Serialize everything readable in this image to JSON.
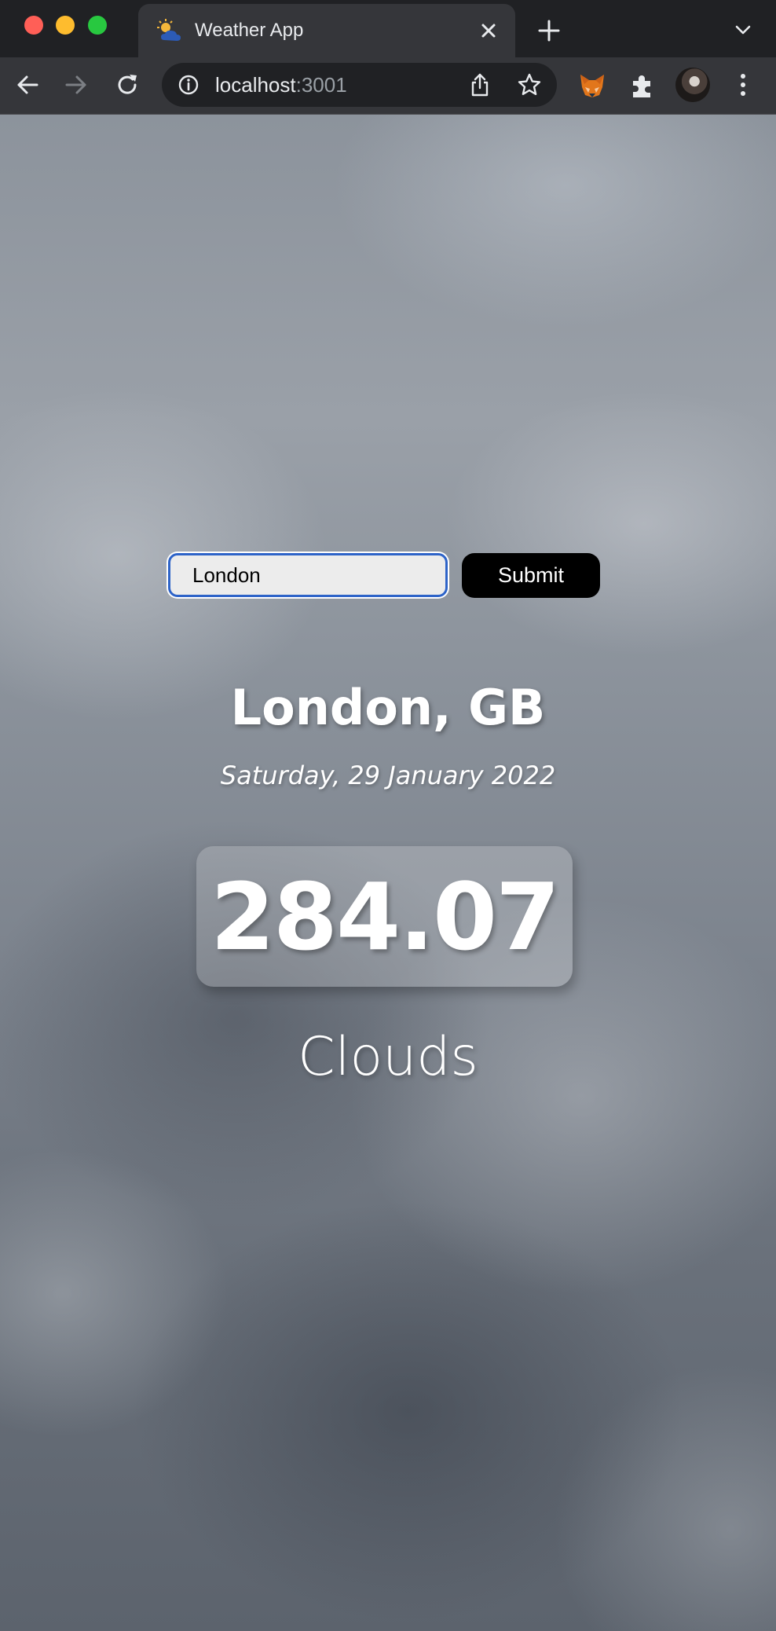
{
  "browser": {
    "tab": {
      "title": "Weather App",
      "favicon": "weather-sun-cloud-icon"
    },
    "address_bar": {
      "host": "localhost",
      "port": ":3001"
    },
    "icons": {
      "back": "back-arrow-icon",
      "forward": "forward-arrow-icon",
      "reload": "reload-icon",
      "info": "info-icon",
      "share": "share-icon",
      "bookmark": "star-icon",
      "metamask": "fox-extension-icon",
      "extensions": "puzzle-icon",
      "menu": "kebab-menu-icon"
    },
    "colors": {
      "frame": "#202124",
      "toolbar": "#35363a",
      "focus_ring": "#2d63c8"
    }
  },
  "weather": {
    "search": {
      "value": "London",
      "placeholder": ""
    },
    "submit_label": "Submit",
    "location": "London, GB",
    "date": "Saturday, 29 January 2022",
    "temperature": "284.07",
    "condition": "Clouds"
  }
}
